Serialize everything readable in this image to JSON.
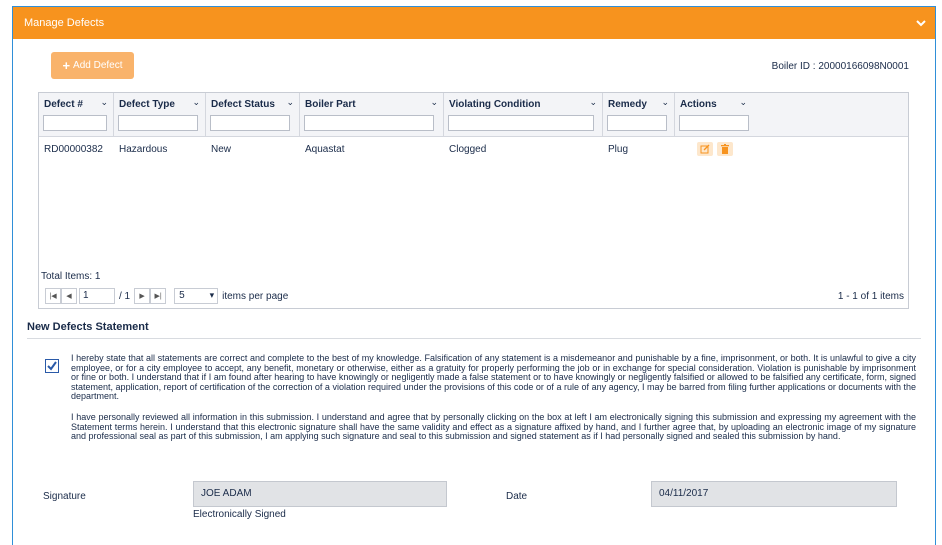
{
  "panel": {
    "title": "Manage Defects",
    "collapse_icon": "chevron-down-icon"
  },
  "toolbar": {
    "add_label": "Add Defect",
    "boiler_id": "Boiler ID : 20000166098N0001"
  },
  "grid": {
    "columns": [
      {
        "label": "Defect #"
      },
      {
        "label": "Defect Type"
      },
      {
        "label": "Defect Status"
      },
      {
        "label": "Boiler Part"
      },
      {
        "label": "Violating Condition"
      },
      {
        "label": "Remedy"
      },
      {
        "label": "Actions"
      }
    ],
    "rows": [
      {
        "defect": "RD00000382",
        "type": "Hazardous",
        "status": "New",
        "part": "Aquastat",
        "condition": "Clogged",
        "remedy": "Plug"
      }
    ],
    "total_items": "Total Items: 1",
    "pager": {
      "page": "1",
      "of_pages": "/ 1",
      "per_page": "5",
      "per_page_label": "items per page",
      "range": "1 - 1 of 1 items"
    }
  },
  "statement": {
    "title": "New Defects Statement",
    "checked": true,
    "para1": "I hereby state that all statements are correct and complete to the best of my knowledge. Falsification of any statement is a misdemeanor and punishable by a fine, imprisonment, or both. It is unlawful to give a city employee, or for a city employee to accept, any benefit, monetary or otherwise, either as a gratuity for properly performing the job or in exchange for special consideration. Violation is punishable by imprisonment or fine or both. I understand that if I am found after hearing to have knowingly or negligently made a false statement or to have knowingly or negligently falsified or allowed to be falsified any certificate, form, signed statement, application, report of certification of the correction of a violation required under the provisions of this code or of a rule of any agency, I may be barred from filing further applications or documents with the department.",
    "para2": "I have personally reviewed all information in this submission. I understand and agree that by personally clicking on the box at left I am electronically signing this submission and expressing my agreement with the Statement terms herein. I understand that this electronic signature shall have the same validity and effect as a signature affixed by hand, and I further agree that, by uploading an electronic image of my signature and professional seal as part of this submission, I am applying such signature and seal to this submission and signed statement as if I had personally signed and sealed this submission by hand."
  },
  "signature": {
    "label": "Signature",
    "value": "JOE ADAM",
    "note": "Electronically Signed",
    "date_label": "Date",
    "date_value": "04/11/2017"
  },
  "colors": {
    "header": "#f7931e",
    "add_button": "#f9b36b",
    "frame": "#2f8fd8",
    "check": "#2a5aa8"
  }
}
